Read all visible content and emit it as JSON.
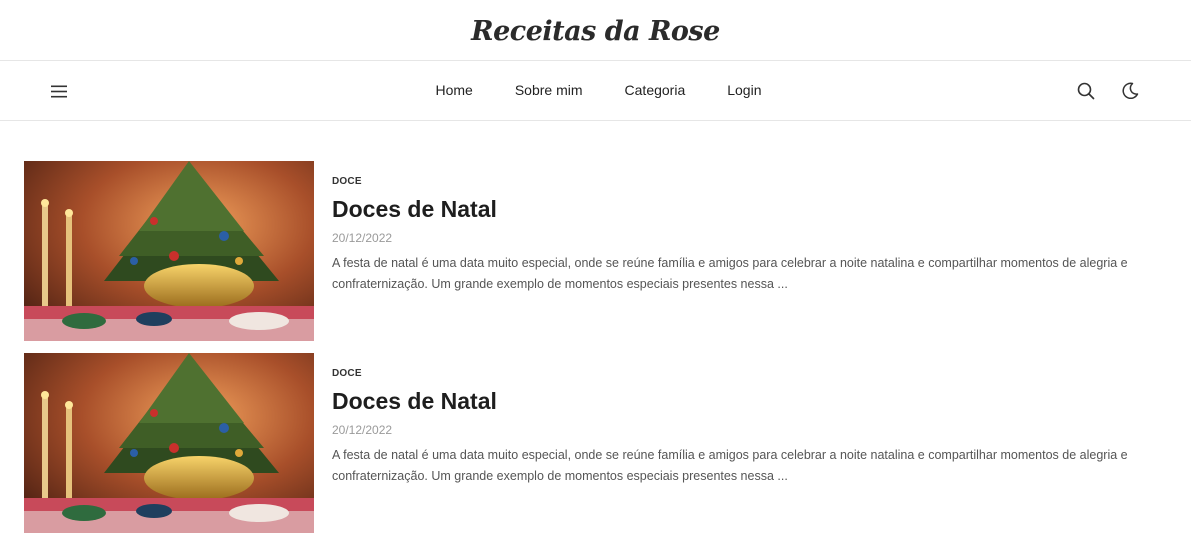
{
  "site": {
    "title": "Receitas da Rose"
  },
  "nav": {
    "links": [
      {
        "label": "Home"
      },
      {
        "label": "Sobre mim"
      },
      {
        "label": "Categoria"
      },
      {
        "label": "Login"
      }
    ],
    "icons": {
      "menu": "hamburger-menu-icon",
      "search": "search-icon",
      "theme": "moon-icon"
    }
  },
  "posts": [
    {
      "category": "DOCE",
      "title": "Doces de Natal",
      "date": "20/12/2022",
      "excerpt": "A festa de natal é uma data muito especial, onde se reúne família e amigos para celebrar a noite natalina e compartilhar momentos de alegria e confraternização. Um grande exemplo de momentos especiais presentes nessa ..."
    },
    {
      "category": "DOCE",
      "title": "Doces de Natal",
      "date": "20/12/2022",
      "excerpt": "A festa de natal é uma data muito especial, onde se reúne família e amigos para celebrar a noite natalina e compartilhar momentos de alegria e confraternização. Um grande exemplo de momentos especiais presentes nessa ..."
    }
  ],
  "colors": {
    "text": "#222222",
    "muted": "#9a9a9a",
    "border": "#e6e6e6"
  }
}
